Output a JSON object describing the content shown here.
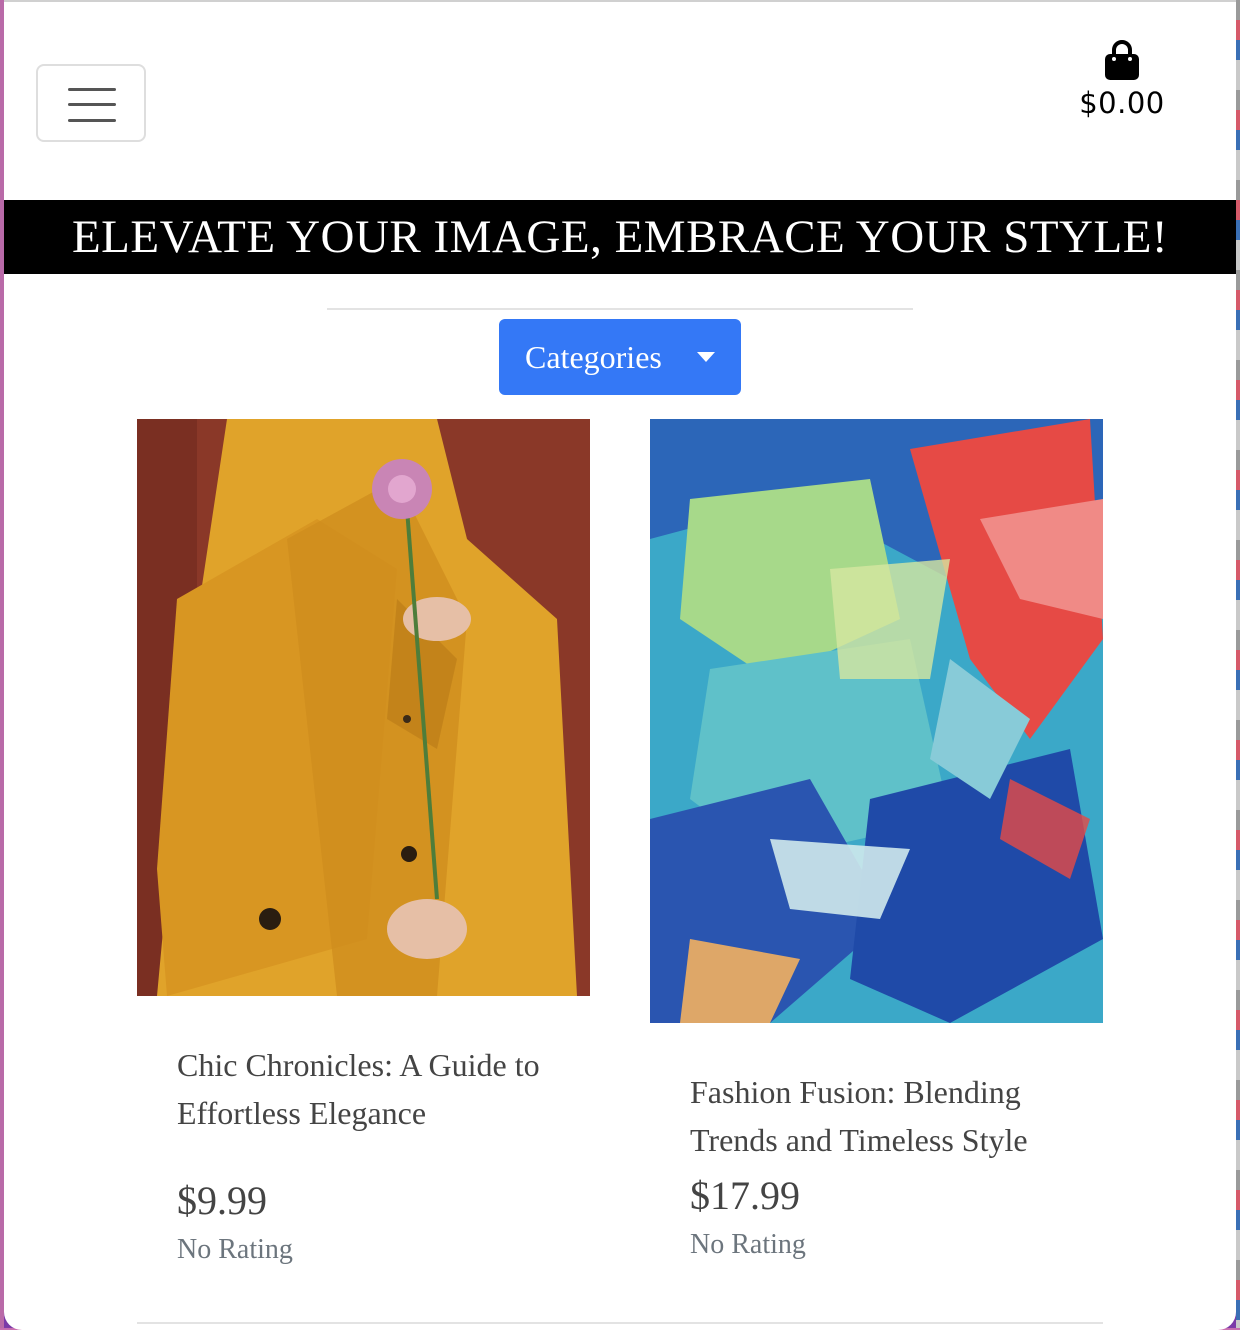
{
  "header": {
    "menu_toggle": "hamburger-menu",
    "cart_icon": "shopping-bag-icon",
    "cart_total": "$0.00"
  },
  "banner": {
    "text": "ELEVATE YOUR IMAGE, EMBRACE YOUR STYLE!"
  },
  "categories": {
    "button_label": "Categories"
  },
  "products": [
    {
      "title": "Chic Chronicles: A Guide to Effortless Elegance",
      "price": "$9.99",
      "rating": "No Rating"
    },
    {
      "title": "Fashion Fusion: Blending Trends and Timeless Style",
      "price": "$17.99",
      "rating": "No Rating"
    }
  ]
}
